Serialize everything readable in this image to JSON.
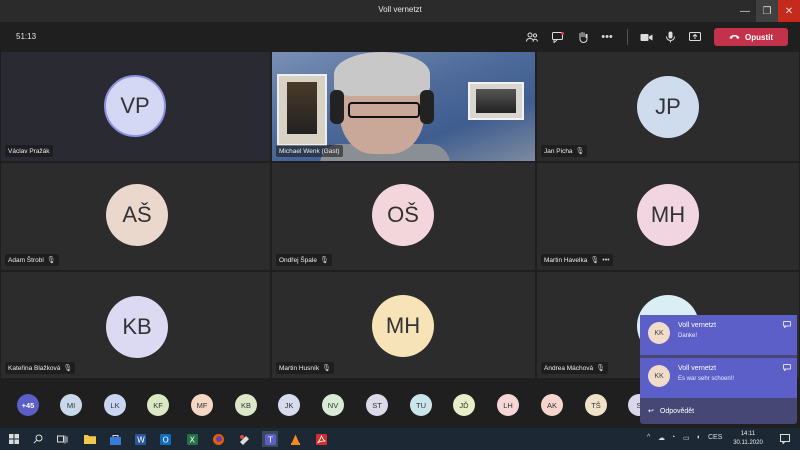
{
  "window": {
    "title": "Voll vernetzt",
    "min_symbol": "—",
    "max_symbol": "❐",
    "close_symbol": "✕"
  },
  "toolbar": {
    "timer": "51:13",
    "leave_label": "Opustit",
    "icons": [
      "participants-icon",
      "chat-icon",
      "raise-hand-icon",
      "more-icon",
      "camera-icon",
      "mic-icon",
      "share-icon"
    ]
  },
  "tiles": [
    {
      "name": "Václav Pražák",
      "initials": "VP",
      "color": "#d4d8f4"
    },
    {
      "name": "Michael Wenk (Gast)",
      "initials": "",
      "color": ""
    },
    {
      "name": "Jan Picha",
      "initials": "JP",
      "color": "#cfdcee"
    },
    {
      "name": "Adam Štrobl",
      "initials": "AŠ",
      "color": "#ead8cc"
    },
    {
      "name": "Ondřej Špale",
      "initials": "OŠ",
      "color": "#f3d6dc"
    },
    {
      "name": "Martin Havelka",
      "initials": "MH",
      "color": "#f1d5e1"
    },
    {
      "name": "Kateřina Blažková",
      "initials": "KB",
      "color": "#dcdaf2"
    },
    {
      "name": "Martin Husník",
      "initials": "MH",
      "color": "#f6e3b7"
    },
    {
      "name": "Andrea Máchová",
      "initials": "",
      "color": "#d9eef5"
    }
  ],
  "strip": {
    "overflow": "+45",
    "chips": [
      {
        "initials": "MI",
        "color": "#c9d9ea"
      },
      {
        "initials": "LK",
        "color": "#c9d6f1"
      },
      {
        "initials": "KF",
        "color": "#dbe8c4"
      },
      {
        "initials": "MF",
        "color": "#f5d8c3"
      },
      {
        "initials": "KB",
        "color": "#dce8c9"
      },
      {
        "initials": "JK",
        "color": "#d6dbee"
      },
      {
        "initials": "NV",
        "color": "#d8ecd5"
      },
      {
        "initials": "ST",
        "color": "#dcdae8"
      },
      {
        "initials": "TU",
        "color": "#cbe6ea"
      },
      {
        "initials": "JĎ",
        "color": "#e8eec8"
      },
      {
        "initials": "LH",
        "color": "#f5d6d6"
      },
      {
        "initials": "AK",
        "color": "#f6d5cf"
      },
      {
        "initials": "TŠ",
        "color": "#f0e2c9"
      },
      {
        "initials": "S",
        "color": "#dad7ea"
      }
    ]
  },
  "notifications": [
    {
      "initials": "KK",
      "title": "Voll vernetzt",
      "message": "Danke!"
    },
    {
      "initials": "KK",
      "title": "Voll vernetzt",
      "message": "Es war sehr schoen!!"
    }
  ],
  "reply_label": "Odpovědět",
  "taskbar": {
    "language": "CES",
    "time": "14:11",
    "date": "30.11.2020"
  }
}
